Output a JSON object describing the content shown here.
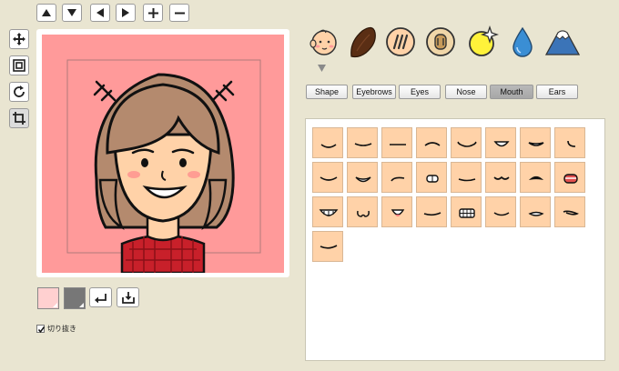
{
  "toolbar": {
    "arrows": [
      "arrow-up-icon",
      "arrow-down-icon",
      "arrow-left-icon",
      "arrow-right-icon"
    ],
    "zoom": [
      "plus-icon",
      "minus-icon"
    ]
  },
  "tools": [
    "move-icon",
    "frame-icon",
    "rotate-icon",
    "crop-icon"
  ],
  "categories": [
    {
      "name": "face-shape-icon"
    },
    {
      "name": "hair-icon"
    },
    {
      "name": "cheek-lines-icon"
    },
    {
      "name": "button-nose-icon"
    },
    {
      "name": "sparkle-moon-icon"
    },
    {
      "name": "drop-icon"
    },
    {
      "name": "mountain-icon"
    }
  ],
  "tabs": [
    {
      "label": "Shape",
      "active": false
    },
    {
      "label": "Eyebrows",
      "active": false
    },
    {
      "label": "Eyes",
      "active": false
    },
    {
      "label": "Nose",
      "active": false
    },
    {
      "label": "Mouth",
      "active": true
    },
    {
      "label": "Ears",
      "active": false
    }
  ],
  "colors": {
    "background_swatch": "#ffd0d0",
    "line_swatch": "#777777",
    "canvas_bg": "#ff9a9a",
    "skin": "#ffd2a8",
    "hair": "#b48a6e",
    "shirt": "#c8202a"
  },
  "bottom_buttons": [
    "undo-icon",
    "download-icon"
  ],
  "cutout": {
    "label": "切り抜き",
    "checked": true
  },
  "mouth_count": 25
}
